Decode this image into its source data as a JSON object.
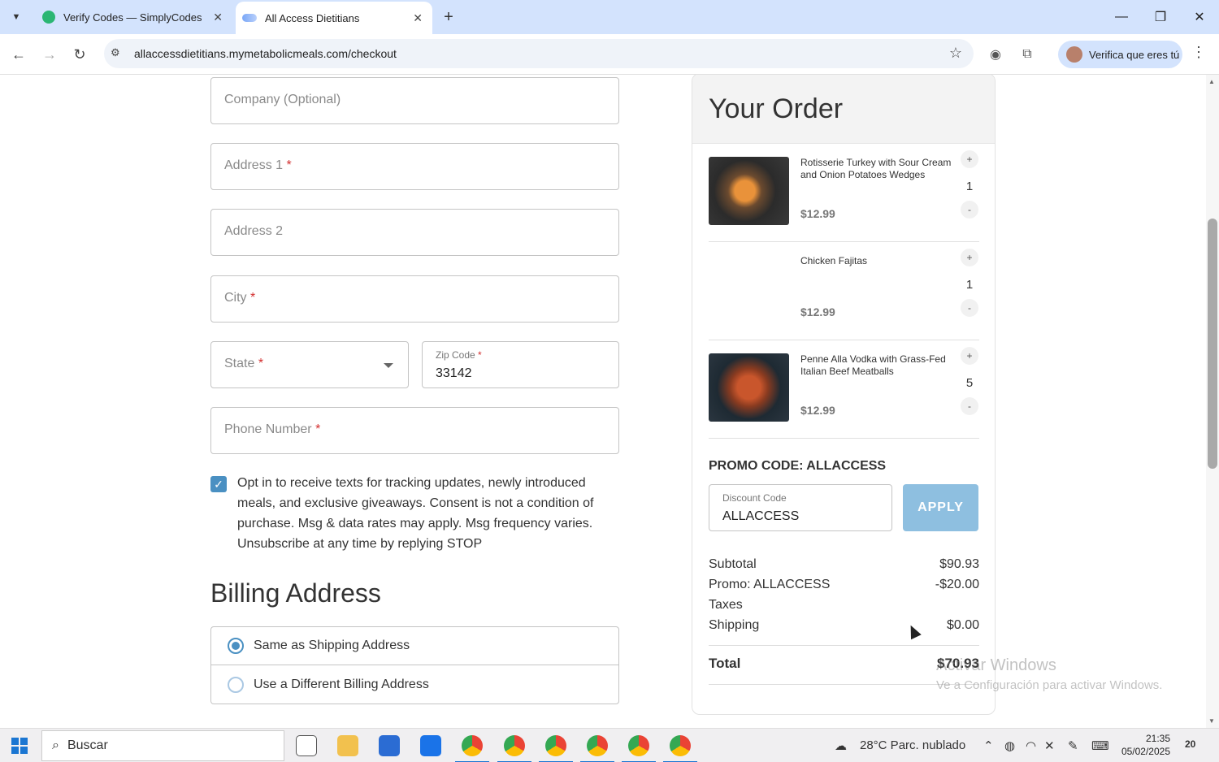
{
  "browser": {
    "tabs": [
      {
        "title": "Verify Codes — SimplyCodes",
        "icon": "simplycodes-favicon"
      },
      {
        "title": "All Access Dietitians",
        "icon": "dietitians-favicon"
      }
    ],
    "url": "allaccessdietitians.mymetabolicmeals.com/checkout",
    "profile_label": "Verifica que eres tú"
  },
  "form": {
    "company_placeholder": "Company (Optional)",
    "address1_placeholder": "Address 1",
    "address2_placeholder": "Address 2",
    "city_placeholder": "City",
    "state_placeholder": "State",
    "zip_label": "Zip Code",
    "zip_value": "33142",
    "phone_placeholder": "Phone Number",
    "required_mark": "*",
    "optin_text": "Opt in to receive texts for tracking updates, newly introduced meals, and exclusive giveaways. Consent is not a condition of purchase. Msg & data rates may apply. Msg frequency varies. Unsubscribe at any time by replying STOP",
    "optin_checked": true
  },
  "billing": {
    "title": "Billing Address",
    "options": [
      "Same as Shipping Address",
      "Use a Different Billing Address"
    ],
    "selected_index": 0
  },
  "order": {
    "title": "Your Order",
    "items": [
      {
        "name": "Rotisserie Turkey with Sour Cream and Onion Potatoes Wedges",
        "price": "$12.99",
        "qty": "1",
        "has_image": true
      },
      {
        "name": "Chicken Fajitas",
        "price": "$12.99",
        "qty": "1",
        "has_image": false
      },
      {
        "name": "Penne Alla Vodka with Grass-Fed Italian Beef Meatballs",
        "price": "$12.99",
        "qty": "5",
        "has_image": true
      }
    ],
    "plus_label": "+",
    "minus_label": "-",
    "promo_title": "PROMO CODE: ALLACCESS",
    "discount_label": "Discount Code",
    "discount_value": "ALLACCESS",
    "apply_label": "APPLY",
    "summary": {
      "subtotal_label": "Subtotal",
      "subtotal": "$90.93",
      "promo_label": "Promo: ALLACCESS",
      "promo": "-$20.00",
      "taxes_label": "Taxes",
      "shipping_label": "Shipping",
      "shipping": "$0.00",
      "total_label": "Total",
      "total": "$70.93"
    }
  },
  "watermark": {
    "line1": "Activar Windows",
    "line2": "Ve a Configuración para activar Windows."
  },
  "taskbar": {
    "search_placeholder": "Buscar",
    "weather": "28°C  Parc. nublado",
    "time": "21:35",
    "date": "05/02/2025",
    "notifications": "20"
  },
  "colors": {
    "accent": "#4a90c2",
    "apply_button": "#8ebfe0",
    "tabbar": "#d3e3fd"
  }
}
